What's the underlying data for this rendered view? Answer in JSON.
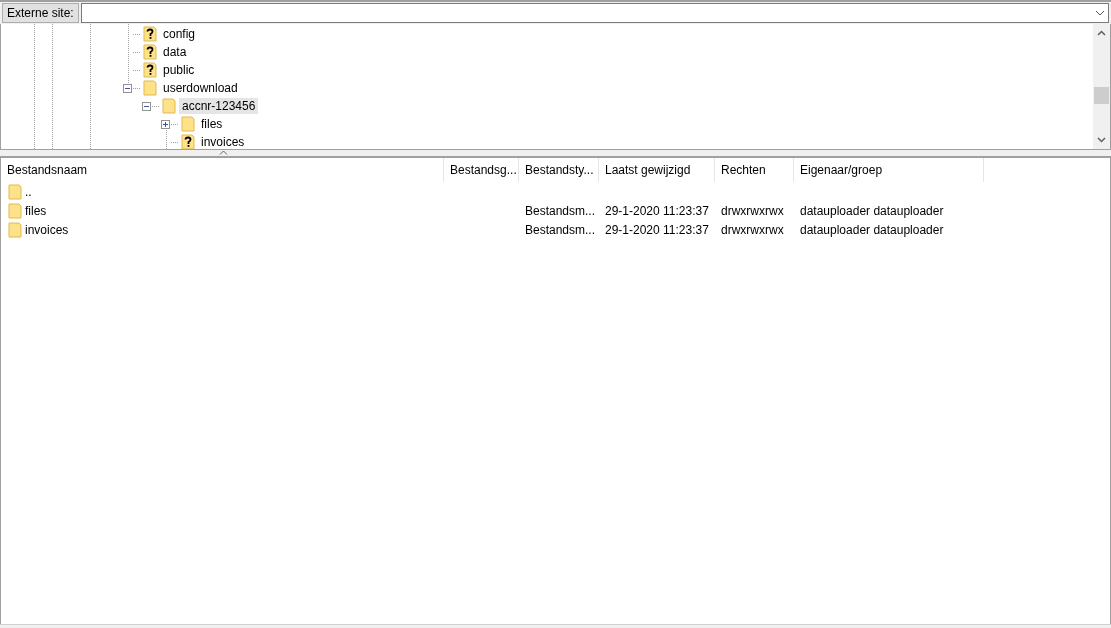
{
  "site_bar": {
    "label": "Externe site:"
  },
  "tree": [
    {
      "name": "config",
      "kind": "unknown",
      "selected": false
    },
    {
      "name": "data",
      "kind": "unknown",
      "selected": false
    },
    {
      "name": "public",
      "kind": "unknown",
      "selected": false
    },
    {
      "name": "userdownload",
      "kind": "folder",
      "expanded": true,
      "selected": false,
      "children": [
        {
          "name": "accnr-123456",
          "kind": "folder",
          "expanded": true,
          "selected": true,
          "children": [
            {
              "name": "files",
              "kind": "folder",
              "expanded": false,
              "selected": false
            },
            {
              "name": "invoices",
              "kind": "unknown",
              "selected": false
            }
          ]
        }
      ]
    }
  ],
  "file_list": {
    "columns": [
      "Bestandsnaam",
      "Bestandsg...",
      "Bestandsty...",
      "Laatst gewijzigd",
      "Rechten",
      "Eigenaar/groep"
    ],
    "rows": [
      {
        "cells": [
          "..",
          "",
          "",
          "",
          "",
          ""
        ],
        "selected": false
      },
      {
        "cells": [
          "files",
          "",
          "Bestandsm...",
          "29-1-2020 11:23:37",
          "drwxrwxrwx",
          "datauploader datauploader"
        ],
        "selected": false
      },
      {
        "cells": [
          "invoices",
          "",
          "Bestandsm...",
          "29-1-2020 11:23:37",
          "drwxrwxrwx",
          "datauploader datauploader"
        ],
        "selected": false
      }
    ]
  }
}
